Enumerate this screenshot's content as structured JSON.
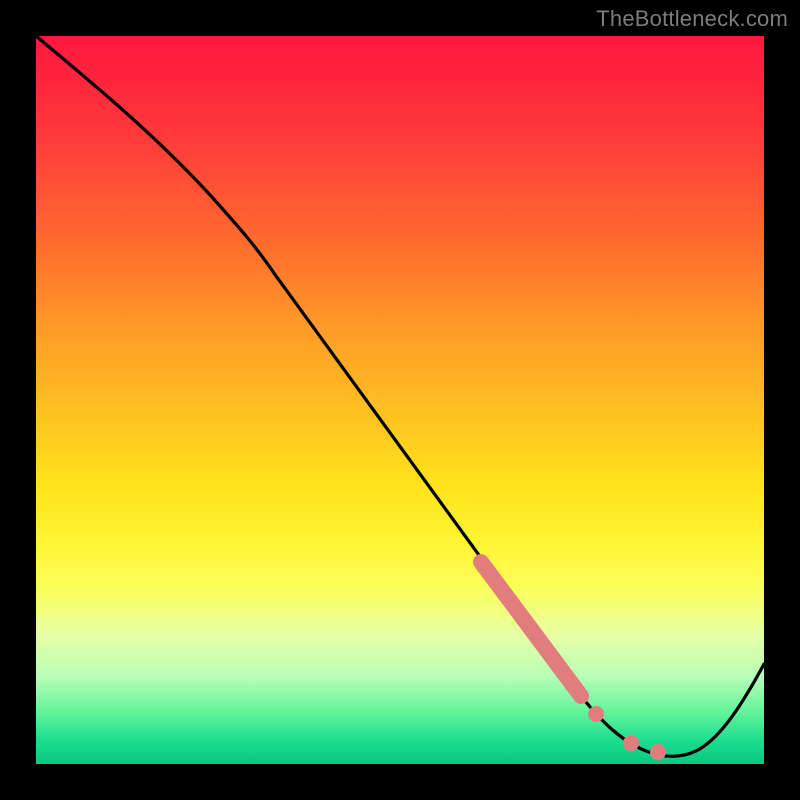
{
  "watermark": "TheBottleneck.com",
  "chart_data": {
    "type": "line",
    "title": "",
    "xlabel": "",
    "ylabel": "",
    "xlim": [
      0,
      100
    ],
    "ylim": [
      0,
      100
    ],
    "grid": false,
    "legend": false,
    "annotations": [],
    "series": [
      {
        "name": "curve",
        "color": "#000000",
        "x": [
          0,
          8,
          15,
          22,
          30,
          40,
          50,
          60,
          66,
          70,
          74,
          78,
          82,
          86,
          90,
          94,
          100
        ],
        "y": [
          100,
          93,
          86,
          77,
          66,
          52,
          38,
          24,
          16,
          11,
          7,
          4,
          2,
          1,
          1,
          5,
          15
        ]
      },
      {
        "name": "highlight-segment",
        "color": "#e57373",
        "type": "scatter",
        "x": [
          60,
          62,
          64,
          66,
          68,
          70,
          72
        ],
        "y": [
          24,
          21.5,
          19,
          16,
          13.5,
          11,
          8.5
        ]
      },
      {
        "name": "highlight-dots",
        "color": "#e57373",
        "type": "scatter",
        "x": [
          75,
          80,
          84
        ],
        "y": [
          6,
          3,
          1.5
        ]
      }
    ]
  }
}
